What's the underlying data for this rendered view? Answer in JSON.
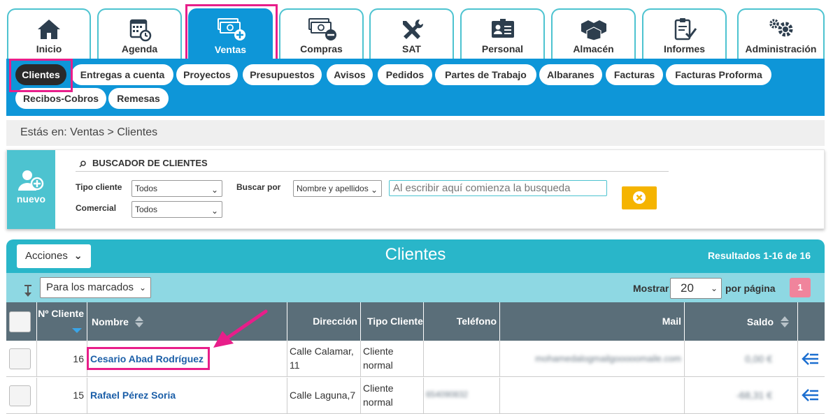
{
  "main_tabs": [
    {
      "label": "Inicio",
      "icon": "home-icon"
    },
    {
      "label": "Agenda",
      "icon": "calendar-clock-icon"
    },
    {
      "label": "Ventas",
      "icon": "money-plus-icon",
      "active": true
    },
    {
      "label": "Compras",
      "icon": "money-minus-icon"
    },
    {
      "label": "SAT",
      "icon": "tools-icon"
    },
    {
      "label": "Personal",
      "icon": "id-card-icon"
    },
    {
      "label": "Almacén",
      "icon": "boxes-icon"
    },
    {
      "label": "Informes",
      "icon": "clipboard-check-icon"
    },
    {
      "label": "Administración",
      "icon": "gears-icon"
    }
  ],
  "sub_nav": [
    {
      "label": "Clientes",
      "active": true
    },
    {
      "label": "Entregas a cuenta"
    },
    {
      "label": "Proyectos"
    },
    {
      "label": "Presupuestos"
    },
    {
      "label": "Avisos"
    },
    {
      "label": "Pedidos"
    },
    {
      "label": "Partes de Trabajo"
    },
    {
      "label": "Albaranes"
    },
    {
      "label": "Facturas"
    },
    {
      "label": "Facturas Proforma"
    },
    {
      "label": "Recibos-Cobros"
    },
    {
      "label": "Remesas"
    }
  ],
  "breadcrumb": "Estás en: Ventas > Clientes",
  "search": {
    "new_label": "nuevo",
    "title": "BUSCADOR DE CLIENTES",
    "tipo_cliente_label": "Tipo cliente",
    "tipo_cliente_value": "Todos",
    "comercial_label": "Comercial",
    "comercial_value": "Todos",
    "buscar_por_label": "Buscar por",
    "buscar_por_value": "Nombre y apellidos",
    "placeholder": "Al escribir aquí comienza la busqueda"
  },
  "results": {
    "acciones_label": "Acciones",
    "title": "Clientes",
    "count": "Resultados 1-16 de 16",
    "marked_label": "Para los marcados",
    "mostrar_label": "Mostrar",
    "per_page_value": "20",
    "per_page_label": "por página",
    "page": "1"
  },
  "table": {
    "columns": [
      "Nº Cliente",
      "Nombre",
      "Dirección",
      "Tipo Cliente",
      "Teléfono",
      "Mail",
      "Saldo"
    ],
    "rows": [
      {
        "num": "16",
        "name": "Cesario Abad Rodríguez",
        "address_1": "Calle Calamar,",
        "address_2": "11",
        "tipo_1": "Cliente",
        "tipo_2": "normal",
        "phone": "",
        "mail": "mohamedalogmailgooooomaile.com",
        "saldo": "0,00 €"
      },
      {
        "num": "15",
        "name": "Rafael Pérez Soria",
        "address_1": "Calle Laguna,7",
        "address_2": "",
        "tipo_1": "Cliente",
        "tipo_2": "normal",
        "phone": "654090832",
        "mail": "",
        "saldo": "-68,31 €"
      }
    ]
  },
  "colors": {
    "primary_blue": "#0e96d8",
    "teal": "#29b6c9",
    "highlight": "#e81e8a",
    "yellow": "#f5b400"
  }
}
